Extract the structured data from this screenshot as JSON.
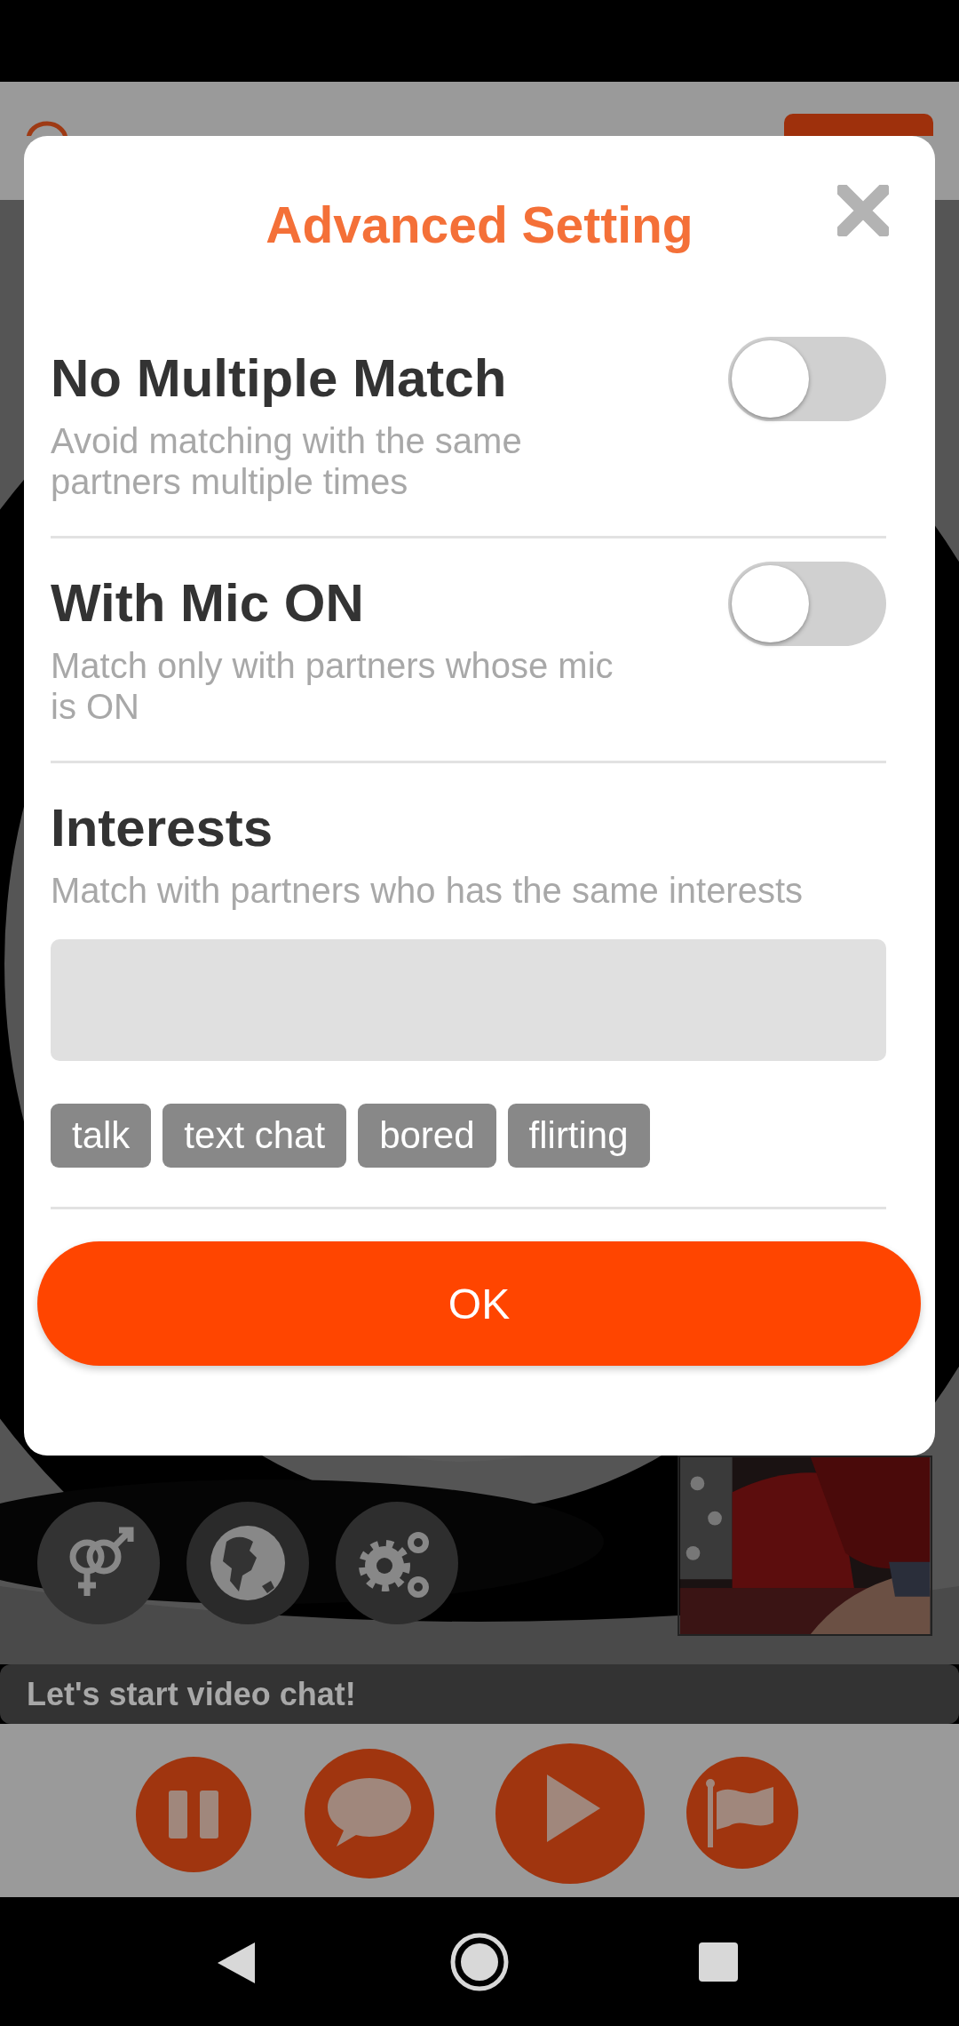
{
  "dialog": {
    "title": "Advanced Setting",
    "settings": [
      {
        "title": "No Multiple Match",
        "description": "Avoid matching with the same partners multiple times",
        "on": false
      },
      {
        "title": "With Mic ON",
        "description": "Match only with partners whose mic is ON",
        "on": false
      }
    ],
    "interests": {
      "title": "Interests",
      "description": "Match with partners who has the same interests",
      "tags": [
        "talk",
        "text chat",
        "bored",
        "flirting"
      ]
    },
    "ok_button": "OK"
  },
  "video": {
    "status_text": "Let's start video chat!"
  }
}
